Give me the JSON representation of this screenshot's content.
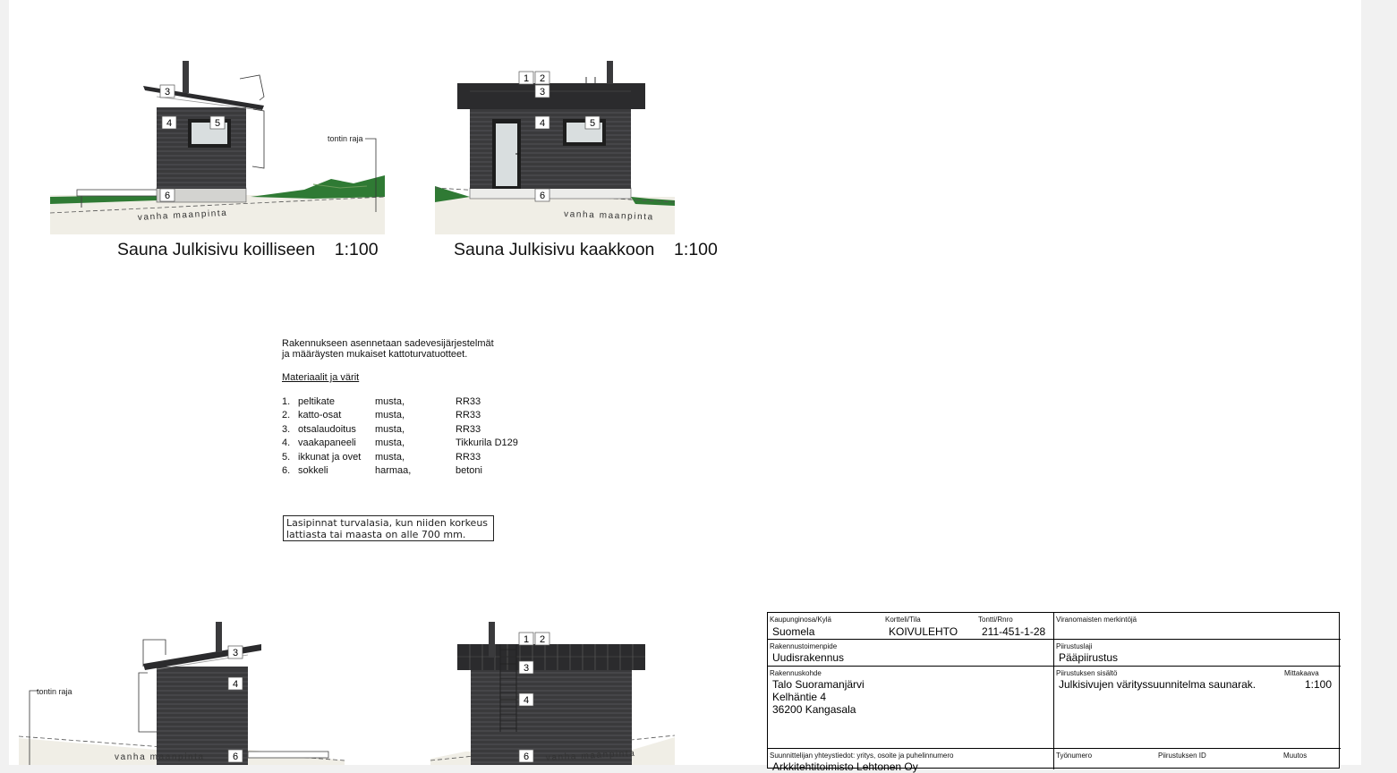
{
  "elevations": {
    "top_left": {
      "caption": "Sauna Julkisivu koilliseen    1:100",
      "tags": [
        "3",
        "4",
        "5",
        "6"
      ],
      "ground_label": "vanha maanpinta",
      "boundary_label": "tontin raja"
    },
    "top_right": {
      "caption": "Sauna Julkisivu kaakkoon    1:100",
      "tags": [
        "1",
        "2",
        "3",
        "4",
        "5",
        "6"
      ],
      "ground_label": "vanha maanpinta"
    },
    "bottom_left": {
      "tags": [
        "3",
        "4",
        "6"
      ],
      "ground_label": "vanha maanpinta",
      "boundary_label": "tontin raja"
    },
    "bottom_right": {
      "tags": [
        "1",
        "2",
        "3",
        "4",
        "6"
      ],
      "ground_label": "vanha maanpinta"
    }
  },
  "notes": {
    "line1": "Rakennukseen asennetaan sadevesijärjestelmät",
    "line2": "ja määräysten mukaiset kattoturvatuotteet.",
    "materials_heading": "Materiaalit ja värit",
    "materials": [
      {
        "no": "1.",
        "part": "peltikate",
        "color": "musta,",
        "code": "RR33"
      },
      {
        "no": "2.",
        "part": "katto-osat",
        "color": "musta,",
        "code": "RR33"
      },
      {
        "no": "3.",
        "part": "otsalaudoitus",
        "color": "musta,",
        "code": "RR33"
      },
      {
        "no": "4.",
        "part": "vaakapaneeli",
        "color": "musta,",
        "code": "Tikkurila D129"
      },
      {
        "no": "5.",
        "part": "ikkunat ja ovet",
        "color": "musta,",
        "code": "RR33"
      },
      {
        "no": "6.",
        "part": "sokkeli",
        "color": "harmaa,",
        "code": "betoni"
      }
    ],
    "warning_line1": "Lasipinnat turvalasia, kun niiden korkeus",
    "warning_line2": "lattiasta tai maasta on alle 700 mm."
  },
  "title_block": {
    "kaupunginosa_label": "Kaupunginosa/Kylä",
    "kaupunginosa_value": "Suomela",
    "kortteli_label": "Kortteli/Tila",
    "kortteli_value": "KOIVULEHTO",
    "tontti_label": "Tontti/Rnro",
    "tontti_value": "211-451-1-28",
    "viranomaisten_label": "Viranomaisten merkintöjä",
    "toimenpide_label": "Rakennustoimenpide",
    "toimenpide_value": "Uudisrakennus",
    "piirustuslaji_label": "Piirustuslaji",
    "piirustuslaji_value": "Pääpiirustus",
    "kohde_label": "Rakennuskohde",
    "kohde_line1": "Talo Suoramanjärvi",
    "kohde_line2": "Kelhäntie 4",
    "kohde_line3": "36200 Kangasala",
    "sisalto_label": "Piirustuksen sisältö",
    "sisalto_value": "Julkisivujen värityssuunnitelma saunarak.",
    "mittakaava_label": "Mittakaava",
    "mittakaava_value": "1:100",
    "suunnittelija_label": "Suunnittelijan yhteystiedot: yritys, osoite ja puhelinnumero",
    "suunnittelija_value": "Arkkitehtitoimisto Lehtonen Oy",
    "tyonumero_label": "Työnumero",
    "piirustus_id_label": "Piirustuksen ID",
    "muutos_label": "Muutos"
  },
  "colors": {
    "cladding": "#3a3a3c",
    "roof": "#2b2b2d",
    "plinth": "#d3d3d0",
    "ground": "#f0eee6",
    "grass": "#2f7a34",
    "glass": "#d9dedf"
  }
}
